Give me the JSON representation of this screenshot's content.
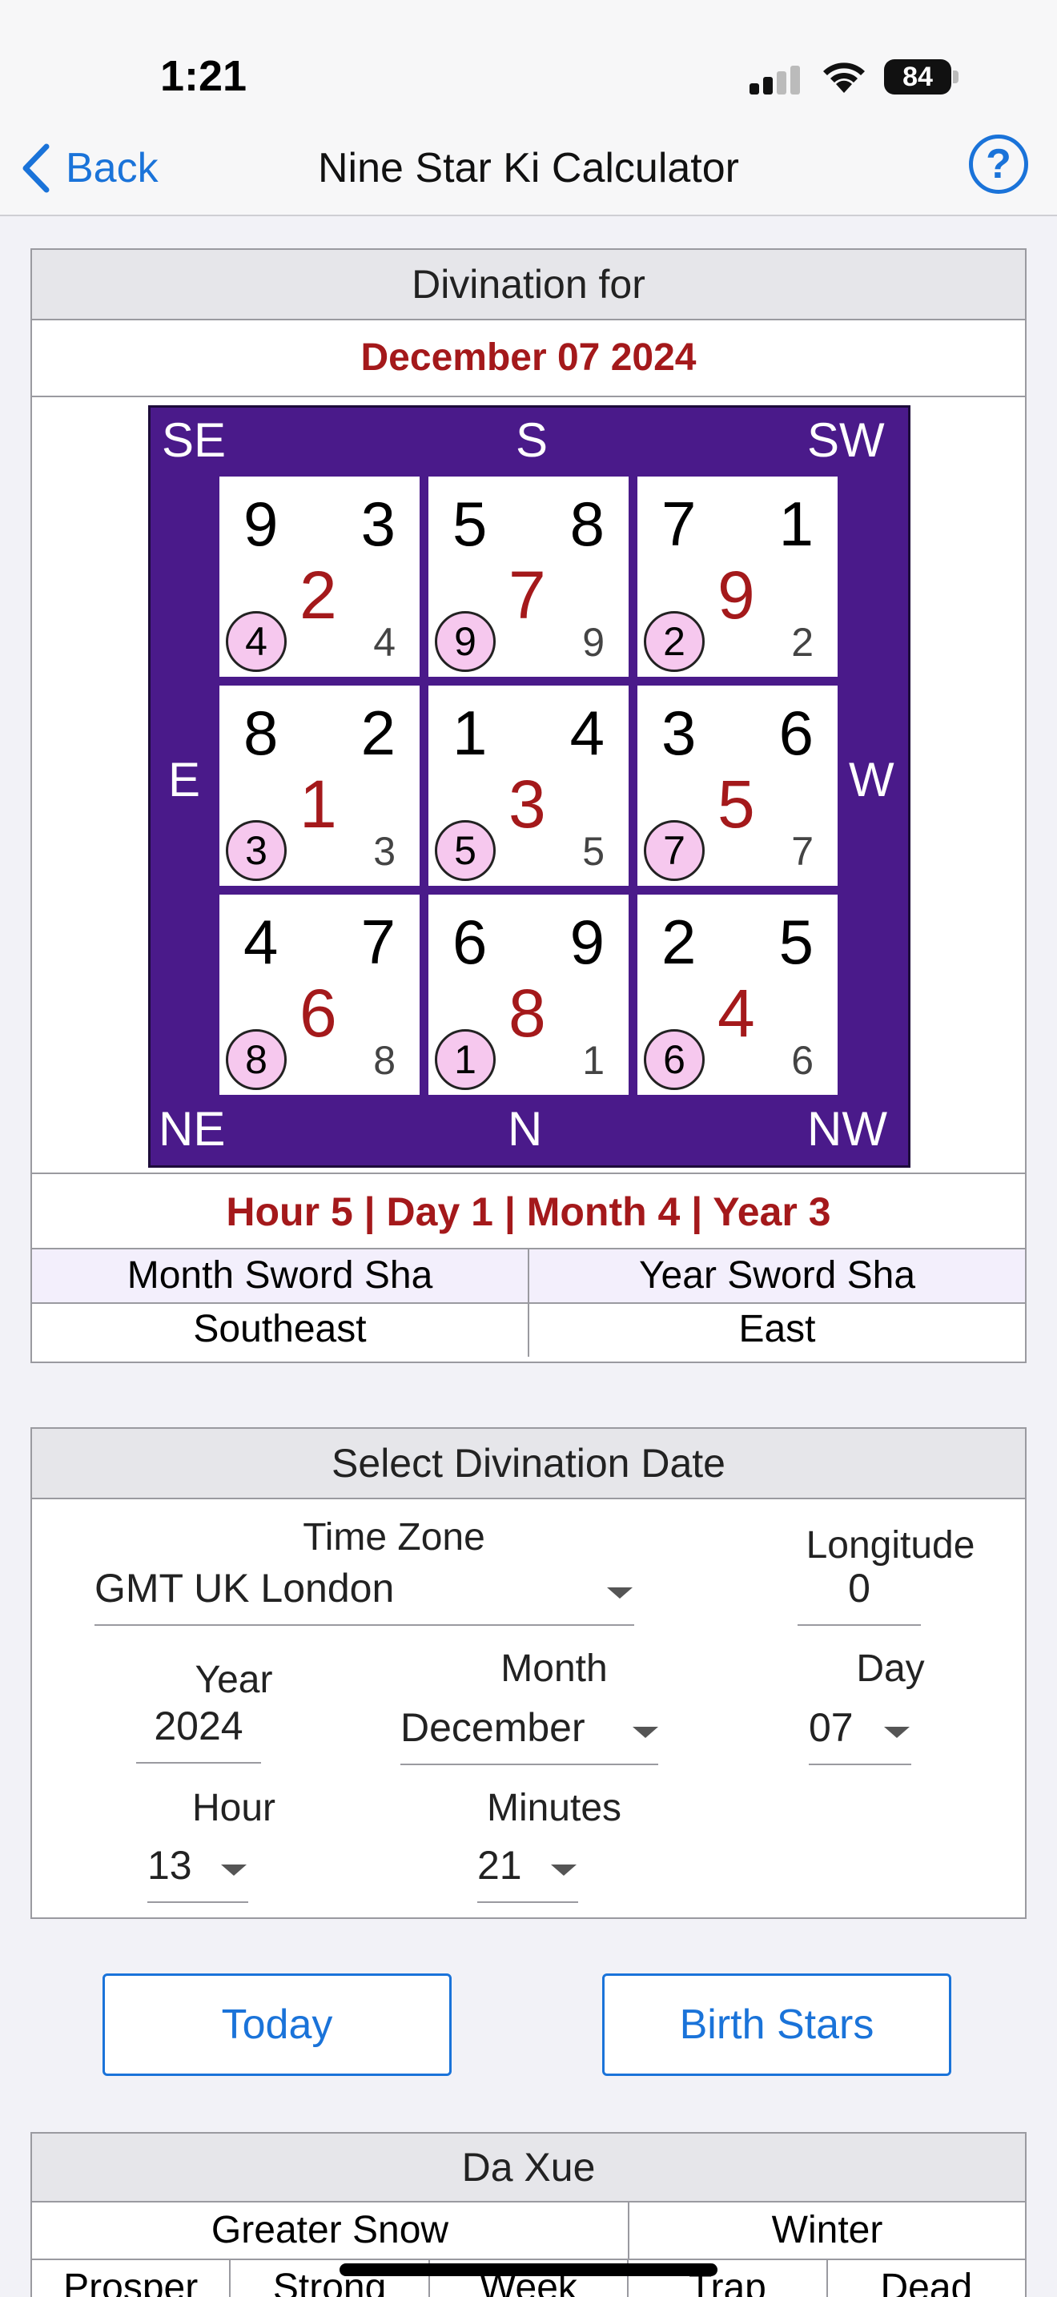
{
  "status_bar": {
    "time": "1:21",
    "battery": "84"
  },
  "nav": {
    "back_label": "Back",
    "title": "Nine Star Ki Calculator",
    "help_label": "?"
  },
  "divination": {
    "header": "Divination for",
    "date": "December 07 2024",
    "directions": {
      "se": "SE",
      "s": "S",
      "sw": "SW",
      "e": "E",
      "w": "W",
      "ne": "NE",
      "n": "N",
      "nw": "NW"
    },
    "cells": [
      {
        "tl": "9",
        "tr": "3",
        "mid": "2",
        "circle": "4",
        "br": "4"
      },
      {
        "tl": "5",
        "tr": "8",
        "mid": "7",
        "circle": "9",
        "br": "9"
      },
      {
        "tl": "7",
        "tr": "1",
        "mid": "9",
        "circle": "2",
        "br": "2"
      },
      {
        "tl": "8",
        "tr": "2",
        "mid": "1",
        "circle": "3",
        "br": "3"
      },
      {
        "tl": "1",
        "tr": "4",
        "mid": "3",
        "circle": "5",
        "br": "5"
      },
      {
        "tl": "3",
        "tr": "6",
        "mid": "5",
        "circle": "7",
        "br": "7"
      },
      {
        "tl": "4",
        "tr": "7",
        "mid": "6",
        "circle": "8",
        "br": "8"
      },
      {
        "tl": "6",
        "tr": "9",
        "mid": "8",
        "circle": "1",
        "br": "1"
      },
      {
        "tl": "2",
        "tr": "5",
        "mid": "4",
        "circle": "6",
        "br": "6"
      }
    ],
    "summary": "Hour 5 | Day 1 | Month 4 | Year 3",
    "sword_headers": [
      "Month Sword Sha",
      "Year Sword Sha"
    ],
    "sword_values": [
      "Southeast",
      "East"
    ]
  },
  "select_date": {
    "header": "Select Divination Date",
    "timezone_label": "Time Zone",
    "timezone_value": "GMT UK London",
    "longitude_label": "Longitude",
    "longitude_value": "0",
    "year_label": "Year",
    "year_value": "2024",
    "month_label": "Month",
    "month_value": "December",
    "day_label": "Day",
    "day_value": "07",
    "hour_label": "Hour",
    "hour_value": "13",
    "minutes_label": "Minutes",
    "minutes_value": "21"
  },
  "buttons": {
    "today": "Today",
    "birth_stars": "Birth Stars"
  },
  "solar_term": {
    "header": "Da Xue",
    "term": "Greater Snow",
    "season": "Winter",
    "columns": [
      "Prosper",
      "Strong",
      "Week",
      "Trap",
      "Dead"
    ]
  },
  "colors": {
    "accent": "#1a73d9",
    "red": "#a4191b",
    "purple": "#4a1a8a",
    "circle_fill": "#f6c8ee"
  }
}
